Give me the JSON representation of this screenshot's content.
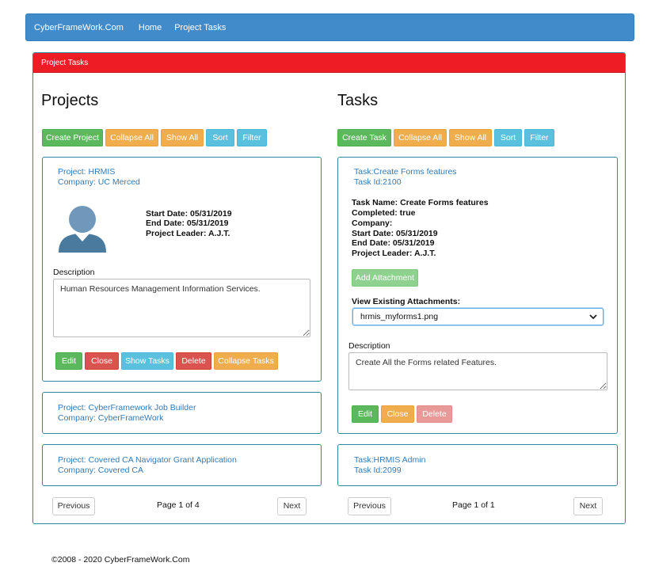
{
  "nav": {
    "brand": "CyberFrameWork.Com",
    "home": "Home",
    "project_tasks": "Project Tasks"
  },
  "panel": {
    "heading": "Project Tasks"
  },
  "projects": {
    "title": "Projects",
    "toolbar": {
      "create": "Create Project",
      "collapse_all": "Collapse All",
      "show_all": "Show All",
      "sort": "Sort",
      "filter": "Filter"
    },
    "expanded": {
      "project": "Project: HRMIS",
      "company": "Company: UC Merced",
      "start_date": "Start Date: 05/31/2019",
      "end_date": "End Date: 05/31/2019",
      "leader": "Project Leader: A.J.T.",
      "description_label": "Description",
      "description": "Human Resources Management Information Services.",
      "actions": {
        "edit": "Edit",
        "close": "Close",
        "show_tasks": "Show Tasks",
        "delete": "Delete",
        "collapse_tasks": "Collapse Tasks"
      }
    },
    "items": [
      {
        "project": "Project: CyberFramework Job Builder",
        "company": "Company: CyberFrameWork"
      },
      {
        "project": "Project: Covered CA Navigator Grant Application",
        "company": "Company: Covered CA"
      }
    ],
    "pager": {
      "previous": "Previous",
      "page": "Page 1 of 4",
      "next": "Next"
    }
  },
  "tasks": {
    "title": "Tasks",
    "toolbar": {
      "create": "Create Task",
      "collapse_all": "Collapse All",
      "show_all": "Show All",
      "sort": "Sort",
      "filter": "Filter"
    },
    "expanded": {
      "task": "Task:Create Forms features",
      "task_id": "Task Id:2100",
      "task_name": "Task Name: Create Forms features",
      "completed": "Completed: true",
      "company": "Company:",
      "start_date": "Start Date: 05/31/2019",
      "end_date": "End Date: 05/31/2019",
      "leader": "Project Leader: A.J.T.",
      "add_attachment": "Add Attachment",
      "attachments_label": "View Existing Attachments:",
      "attachment_selected": "hrmis_myforms1.png",
      "description_label": "Description",
      "description": "Create All the Forms related Features.",
      "actions": {
        "edit": "Edit",
        "close": "Close",
        "delete": "Delete"
      }
    },
    "items": [
      {
        "task": "Task:HRMIS Admin",
        "task_id": "Task Id:2099"
      }
    ],
    "pager": {
      "previous": "Previous",
      "page": "Page 1 of 1",
      "next": "Next"
    }
  },
  "footer": "©2008 - 2020 CyberFrameWork.Com",
  "colors": {
    "navbar": "#428bca",
    "panel_heading": "#ee1c25",
    "card_border": "#2b8a9e",
    "link": "#337ab7"
  },
  "icons": {
    "avatar": "user-avatar-icon",
    "dropdown": "chevron-down-icon"
  }
}
